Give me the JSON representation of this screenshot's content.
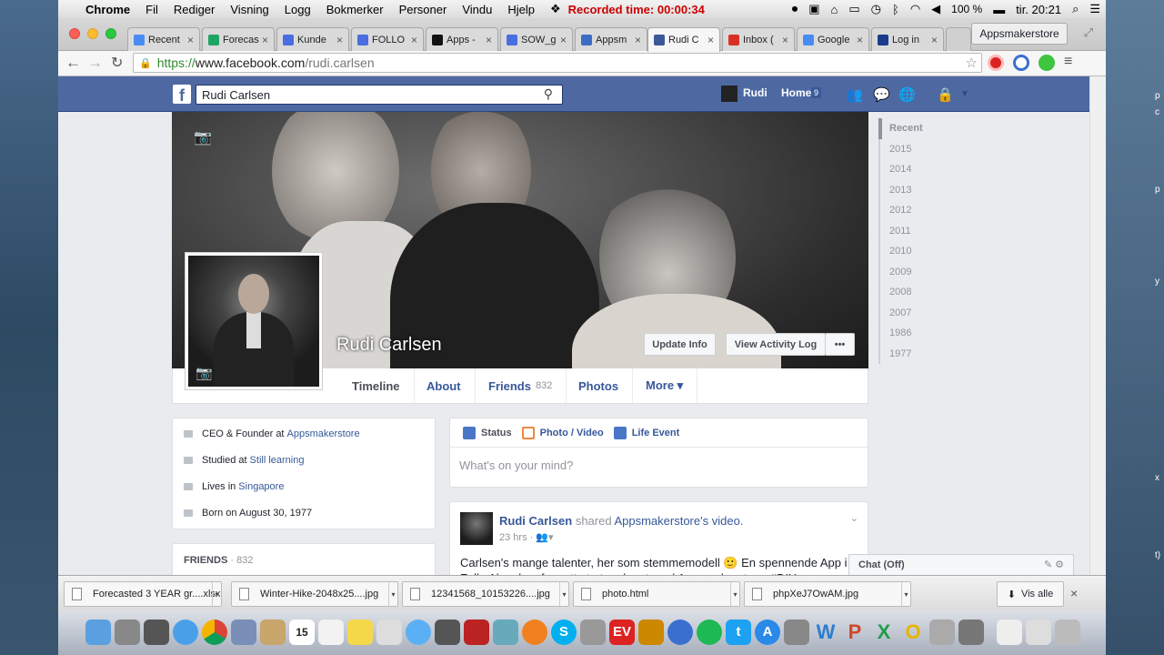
{
  "menubar": {
    "app": "Chrome",
    "items": [
      "Fil",
      "Rediger",
      "Visning",
      "Logg",
      "Bokmerker",
      "Personer",
      "Vindu",
      "Hjelp"
    ],
    "recorded": "Recorded time: 00:00:34",
    "battery": "100 %",
    "clock": "tir. 20:21"
  },
  "tabs": [
    {
      "label": "Recent",
      "color": "#4a8af4"
    },
    {
      "label": "Forecas",
      "color": "#1fa463"
    },
    {
      "label": "Kunde",
      "color": "#4a6ee0"
    },
    {
      "label": "FOLLO",
      "color": "#4a6ee0"
    },
    {
      "label": "Apps -",
      "color": "#111111"
    },
    {
      "label": "SOW_g",
      "color": "#4a6ee0"
    },
    {
      "label": "Appsm",
      "color": "#3b6cc4"
    },
    {
      "label": "Rudi C",
      "color": "#3b5998"
    },
    {
      "label": "Inbox (",
      "color": "#d93025"
    },
    {
      "label": "Google",
      "color": "#4a8af4"
    },
    {
      "label": "Log in",
      "color": "#1a3c8c"
    }
  ],
  "profile_button": "Appsmakerstore",
  "omnibox": {
    "scheme": "https://",
    "host": "www.facebook.com",
    "path": "/rudi.carlsen"
  },
  "fb": {
    "search_value": "Rudi Carlsen",
    "user": "Rudi",
    "home": "Home",
    "home_count": "9"
  },
  "profile": {
    "name": "Rudi Carlsen",
    "update_info": "Update Info",
    "activity_log": "View Activity Log",
    "more_dots": "•••",
    "nav": [
      {
        "label": "Timeline",
        "count": ""
      },
      {
        "label": "About",
        "count": ""
      },
      {
        "label": "Friends",
        "count": "832"
      },
      {
        "label": "Photos",
        "count": ""
      },
      {
        "label": "More ▾",
        "count": ""
      }
    ]
  },
  "intro": {
    "work_pre": "CEO & Founder at",
    "work_link": "Appsmakerstore",
    "study_pre": "Studied at",
    "study_link": "Still learning",
    "lives_pre": "Lives in",
    "lives_link": "Singapore",
    "born": "Born on August 30, 1977"
  },
  "friends": {
    "label": "FRIENDS",
    "count": "· 832"
  },
  "composer": {
    "status": "Status",
    "photo": "Photo / Video",
    "life": "Life Event",
    "placeholder": "What's on your mind?"
  },
  "post": {
    "author": "Rudi Carlsen",
    "shared": "shared",
    "page": "Appsmakerstore",
    "suffix": "'s video.",
    "time": "23 hrs ·",
    "body": "Carlsen's mange talenter, her som stemmemodell 🙂 En spennende App i Follo Akershus for nytt start up laget med Appsmakerstore. #DIY #MobileApp"
  },
  "years": [
    "Recent",
    "2015",
    "2014",
    "2013",
    "2012",
    "2011",
    "2010",
    "2009",
    "2008",
    "2007",
    "1986",
    "1977"
  ],
  "chat": "Chat (Off)",
  "downloads": [
    "Forecasted 3 YEAR gr....xlsx",
    "Winter-Hike-2048x25....jpg",
    "12341568_10153226....jpg",
    "photo.html",
    "phpXeJ7OwAM.jpg"
  ],
  "downloads_show_all": "Vis alle"
}
